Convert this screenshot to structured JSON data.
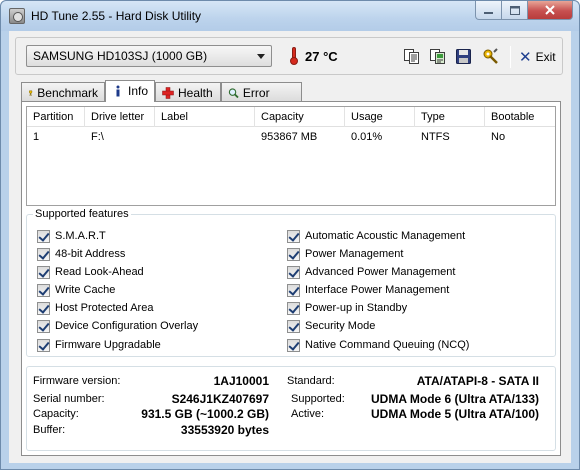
{
  "window": {
    "title": "HD Tune 2.55 - Hard Disk Utility"
  },
  "toolbar": {
    "drive": "SAMSUNG HD103SJ (1000 GB)",
    "temperature": "27 °C",
    "exit_label": "Exit",
    "icons": [
      "copy-text-icon",
      "copy-screenshot-icon",
      "save-icon",
      "options-icon",
      "exit-icon"
    ]
  },
  "tabs": [
    {
      "label": "Benchmark",
      "icon": "benchmark-icon"
    },
    {
      "label": "Info",
      "icon": "info-icon",
      "active": true
    },
    {
      "label": "Health",
      "icon": "health-icon"
    },
    {
      "label": "Error Scan",
      "icon": "magnifier-icon"
    }
  ],
  "partitions": {
    "columns": [
      "Partition",
      "Drive letter",
      "Label",
      "Capacity",
      "Usage",
      "Type",
      "Bootable"
    ],
    "rows": [
      [
        "1",
        "F:\\",
        "",
        "953867 MB",
        "0.01%",
        "NTFS",
        "No"
      ]
    ]
  },
  "features": {
    "title": "Supported features",
    "left": [
      "S.M.A.R.T",
      "48-bit Address",
      "Read Look-Ahead",
      "Write Cache",
      "Host Protected Area",
      "Device Configuration Overlay",
      "Firmware Upgradable"
    ],
    "right": [
      "Automatic Acoustic Management",
      "Power Management",
      "Advanced Power Management",
      "Interface Power Management",
      "Power-up in Standby",
      "Security Mode",
      "Native Command Queuing (NCQ)"
    ]
  },
  "details": {
    "firmware_label": "Firmware version:",
    "firmware": "1AJ10001",
    "serial_label": "Serial number:",
    "serial": "S246J1KZ407697",
    "capacity_label": "Capacity:",
    "capacity": "931.5 GB (~1000.2 GB)",
    "buffer_label": "Buffer:",
    "buffer": "33553920 bytes",
    "standard_label": "Standard:",
    "standard": "ATA/ATAPI-8 - SATA II",
    "supported_label": "Supported:",
    "supported": "UDMA Mode 6 (Ultra ATA/133)",
    "active_label": "Active:",
    "active": "UDMA Mode 5 (Ultra ATA/100)"
  }
}
